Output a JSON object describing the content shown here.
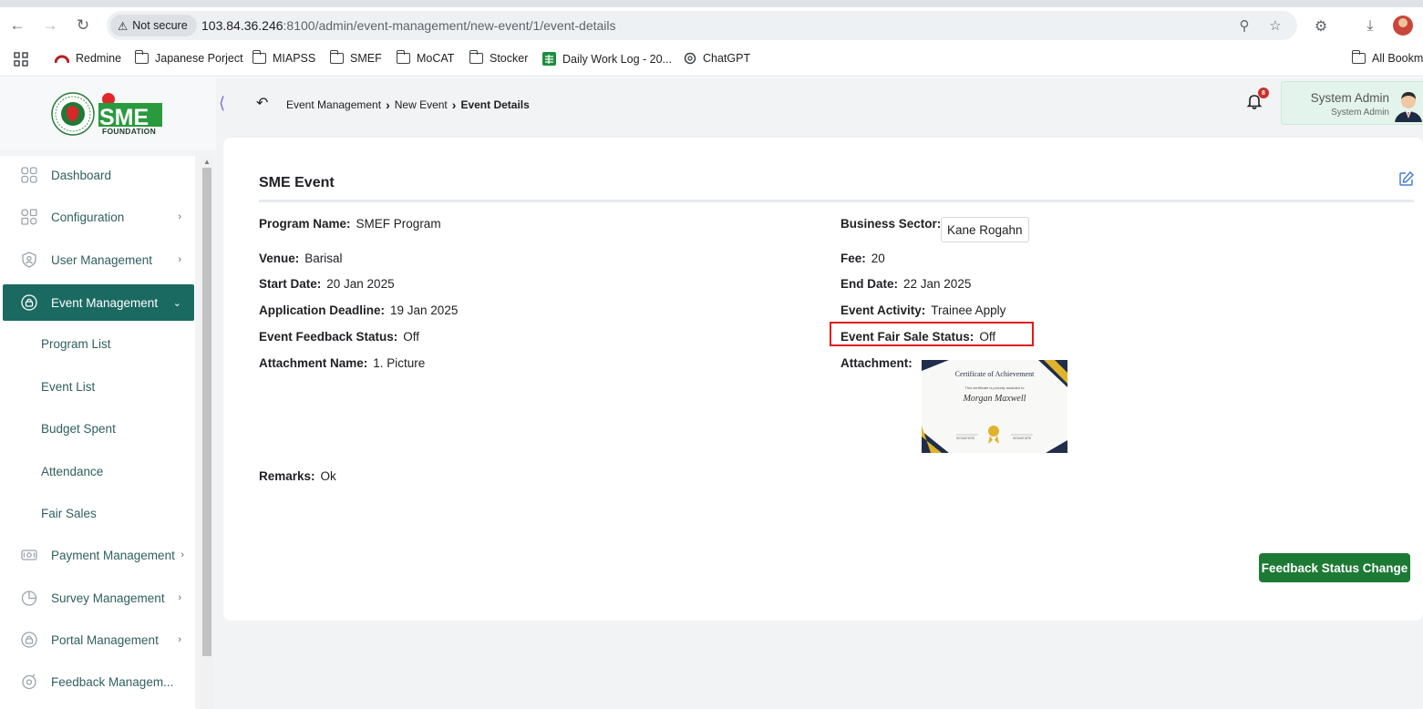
{
  "browser": {
    "security_label": "Not secure",
    "url_host": "103.84.36.246",
    "url_rest": ":8100/admin/event-management/new-event/1/event-details",
    "bookmarks": [
      "Redmine",
      "Japanese Porject",
      "MIAPSS",
      "SMEF",
      "MoCAT",
      "Stocker",
      "Daily Work Log - 20...",
      "ChatGPT"
    ],
    "all_bookmarks": "All Bookm"
  },
  "logo": {
    "brand": "SME",
    "sub": "FOUNDATION"
  },
  "sidebar": {
    "items": [
      {
        "label": "Dashboard",
        "icon": "dashboard-icon"
      },
      {
        "label": "Configuration",
        "icon": "configuration-icon"
      },
      {
        "label": "User Management",
        "icon": "user-icon"
      },
      {
        "label": "Event Management",
        "icon": "lock-icon"
      },
      {
        "label": "Payment Management",
        "icon": "payment-icon"
      },
      {
        "label": "Survey Management",
        "icon": "pie-chart-icon"
      },
      {
        "label": "Portal Management",
        "icon": "portal-icon"
      },
      {
        "label": "Feedback Managem...",
        "icon": "feedback-icon"
      }
    ],
    "sub_items": [
      "Program List",
      "Event List",
      "Budget Spent",
      "Attendance",
      "Fair Sales"
    ]
  },
  "topbar": {
    "breadcrumb": [
      "Event Management",
      "New Event",
      "Event Details"
    ],
    "notification_count": "8",
    "user_name": "System Admin",
    "user_role": "System Admin"
  },
  "card": {
    "title": "SME Event",
    "fields": {
      "program_name": {
        "label": "Program Name:",
        "value": "SMEF Program"
      },
      "business_sector": {
        "label": "Business Sector:",
        "value": "Kane Rogahn"
      },
      "venue": {
        "label": "Venue:",
        "value": "Barisal"
      },
      "fee": {
        "label": "Fee:",
        "value": "20"
      },
      "start_date": {
        "label": "Start Date:",
        "value": "20 Jan 2025"
      },
      "end_date": {
        "label": "End Date:",
        "value": "22 Jan 2025"
      },
      "application_deadline": {
        "label": "Application Deadline:",
        "value": "19 Jan 2025"
      },
      "event_activity": {
        "label": "Event Activity:",
        "value": "Trainee Apply"
      },
      "event_feedback_status": {
        "label": "Event Feedback Status:",
        "value": "Off"
      },
      "event_fair_sale_status": {
        "label": "Event Fair Sale Status:",
        "value": "Off"
      },
      "attachment_name": {
        "label": "Attachment Name:",
        "value": "1. Picture"
      },
      "attachment": {
        "label": "Attachment:"
      },
      "remarks": {
        "label": "Remarks:",
        "value": "Ok"
      }
    },
    "certificate": {
      "heading": "Certificate of Achievement",
      "line": "This certificate is proudly awarded to",
      "name": "Morgan Maxwell",
      "sign_left": "SIGNATURE",
      "sign_right": "SIGNATURE"
    },
    "feedback_button": "Feedback Status Change"
  },
  "colors": {
    "sidebar_active": "#1b6a62",
    "button_green": "#1d7a35",
    "highlight_red": "#e01b1b",
    "badge_red": "#c9302c"
  }
}
